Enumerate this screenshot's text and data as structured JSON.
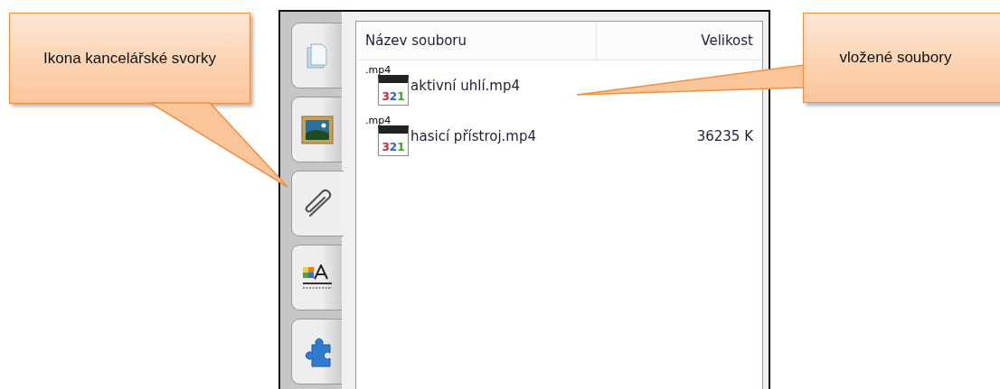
{
  "callouts": [
    {
      "text": "Ikona kancelářské svorky"
    },
    {
      "text": "vložené soubory"
    }
  ],
  "tabs": [
    {
      "kind": "page",
      "selected": false
    },
    {
      "kind": "image",
      "selected": false
    },
    {
      "kind": "paperclip",
      "selected": true
    },
    {
      "kind": "format",
      "selected": false
    },
    {
      "kind": "puzzle",
      "selected": false
    }
  ],
  "file_list": {
    "columns": [
      "Název souboru",
      "Velikost"
    ],
    "rows": [
      {
        "badge": ".mp4",
        "digits": "321",
        "name": "aktivní uhlí.mp4"
      },
      {
        "badge": ".mp4",
        "digits": "321",
        "name": "hasicí přístroj.mp4",
        "size": "36235 K"
      }
    ]
  }
}
